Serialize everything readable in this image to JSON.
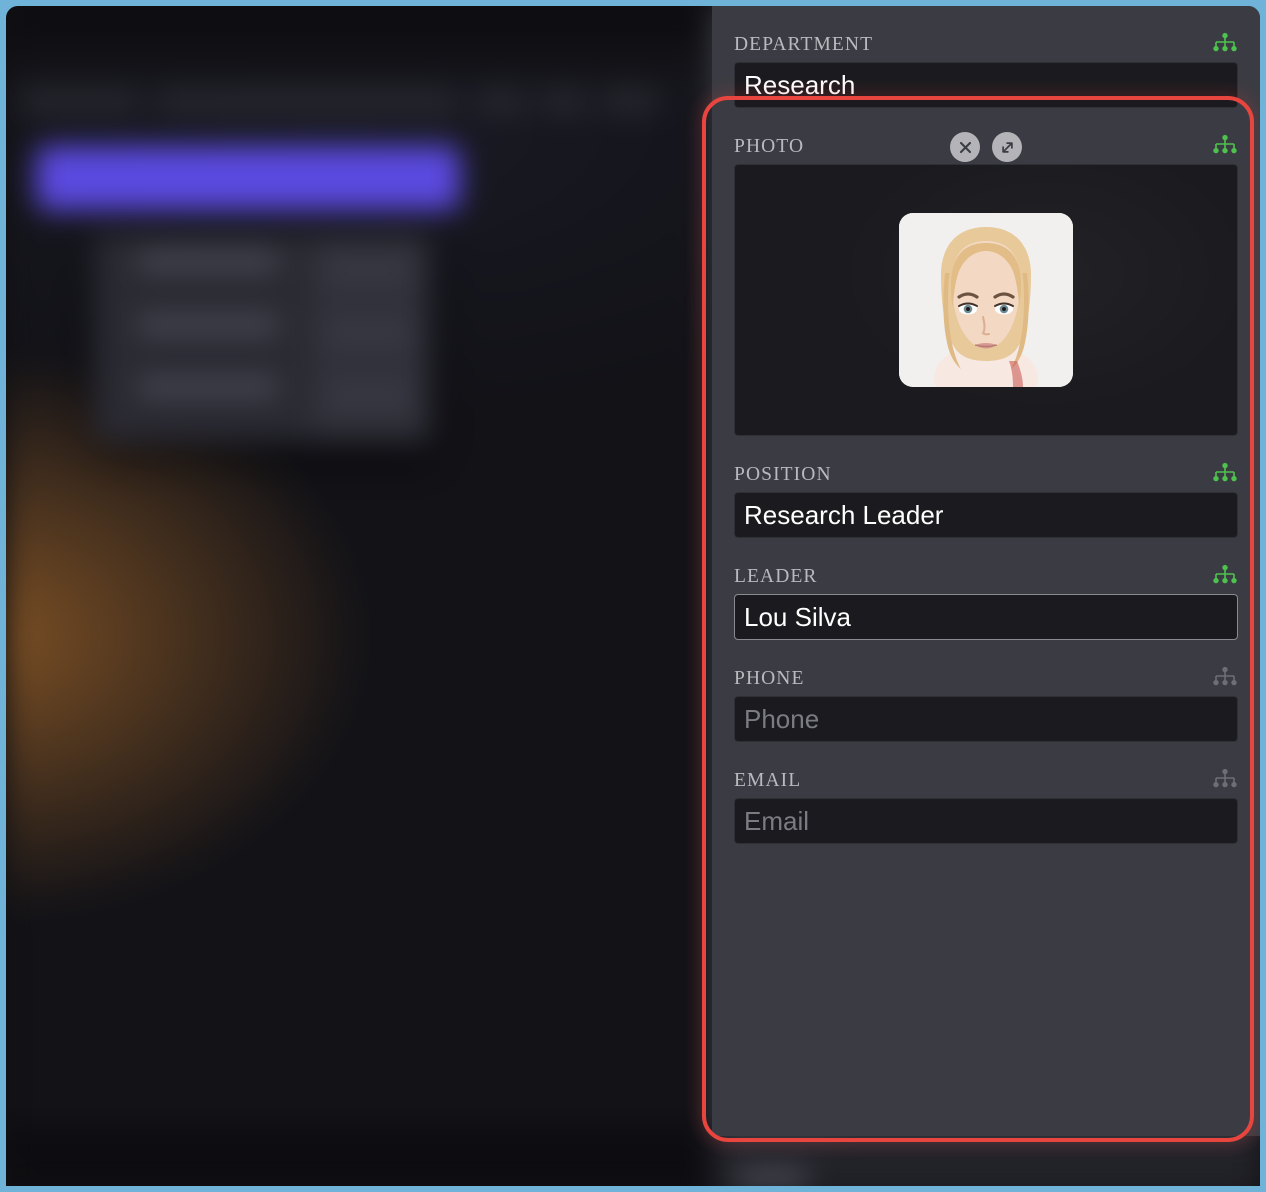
{
  "colors": {
    "frame_border": "#6fb4d8",
    "highlight_ring": "#e8453f",
    "panel_bg": "#3b3c43",
    "input_bg": "#1b1b1f",
    "label_text": "#b9b9bf",
    "value_text": "#ffffff",
    "placeholder_text": "#7b7b82",
    "hierarchy_icon_active": "#4ec24e",
    "hierarchy_icon_inactive": "#6d6e76",
    "accent_blue": "#5b4ae0",
    "circle_button_bg": "#b3b3b8"
  },
  "panel": {
    "name": "department-detail-form",
    "fields": [
      {
        "id": "department",
        "label": "DEPARTMENT",
        "value": "Research",
        "placeholder": "Department",
        "type": "text",
        "filled": true,
        "focused": false,
        "icon": "hierarchy-icon",
        "icon_state": "active"
      },
      {
        "id": "photo",
        "label": "PHOTO",
        "type": "image",
        "icon": "hierarchy-icon",
        "icon_state": "active",
        "buttons": [
          {
            "id": "clear-photo",
            "icon": "close-icon",
            "label": "Clear photo"
          },
          {
            "id": "expand-photo",
            "icon": "expand-arrows-icon",
            "label": "Expand photo"
          }
        ],
        "image_alt": "Portrait of a blonde woman with a shoulder-length bob"
      },
      {
        "id": "position",
        "label": "POSITION",
        "value": "Research Leader",
        "placeholder": "Position",
        "type": "text",
        "filled": true,
        "focused": false,
        "icon": "hierarchy-icon",
        "icon_state": "active"
      },
      {
        "id": "leader",
        "label": "LEADER",
        "value": "Lou Silva",
        "placeholder": "Leader",
        "type": "text",
        "filled": true,
        "focused": true,
        "icon": "hierarchy-icon",
        "icon_state": "active"
      },
      {
        "id": "phone",
        "label": "PHONE",
        "value": "",
        "placeholder": "Phone",
        "type": "tel",
        "filled": false,
        "focused": false,
        "icon": "hierarchy-icon",
        "icon_state": "inactive"
      },
      {
        "id": "email",
        "label": "EMAIL",
        "value": "",
        "placeholder": "Email",
        "type": "email",
        "filled": false,
        "focused": false,
        "icon": "hierarchy-icon",
        "icon_state": "inactive"
      }
    ]
  }
}
